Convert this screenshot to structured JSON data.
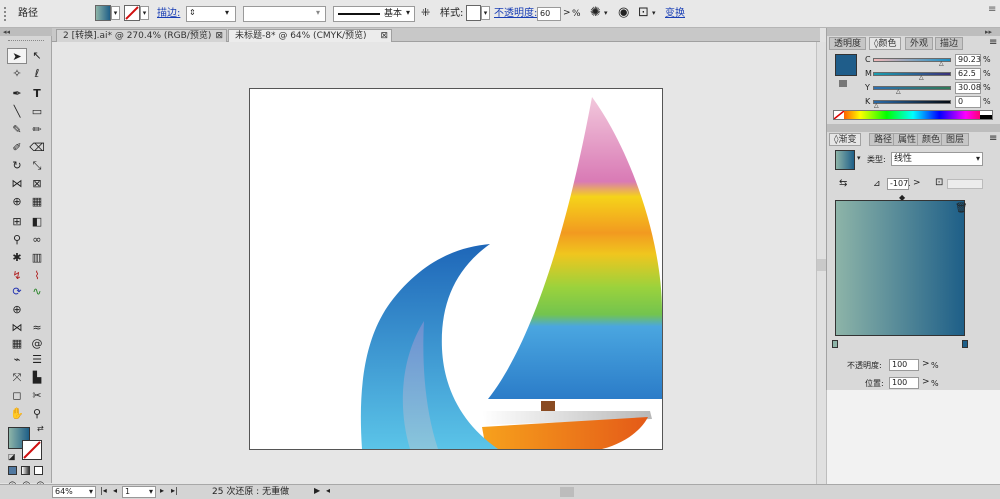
{
  "control_bar": {
    "selection_type": "路径",
    "stroke_label": "描边:",
    "stroke_weight": "",
    "brush_style": "基本",
    "style_label": "样式:",
    "opacity_label": "不透明度:",
    "opacity_value": "60",
    "opacity_unit": "%",
    "transform_label": "变换",
    "fill_color": "#4a7fa0"
  },
  "document_tabs": [
    {
      "label": "2 [转换].ai* @ 270.4% (RGB/预览)",
      "close": "⊠",
      "active": false
    },
    {
      "label": "未标题-8* @ 64% (CMYK/预览)",
      "close": "⊠",
      "active": true
    }
  ],
  "color_panel": {
    "tabs": [
      "透明度",
      "颜色",
      "外观",
      "描边"
    ],
    "active_tab": "颜色",
    "channels": [
      {
        "label": "C",
        "value": "90.23",
        "fraction": 0.9023
      },
      {
        "label": "M",
        "value": "62.5",
        "fraction": 0.625
      },
      {
        "label": "Y",
        "value": "30.08",
        "fraction": 0.3008
      },
      {
        "label": "K",
        "value": "0",
        "fraction": 0
      }
    ],
    "current_color": "#1f5d8a"
  },
  "gradient_panel": {
    "tabs": [
      "渐变",
      "路径",
      "属性",
      "颜色",
      "图层"
    ],
    "active_tab": "渐变",
    "type_label": "类型:",
    "type_value": "线性",
    "angle_value": "-107.",
    "start_color": "#8db4a8",
    "end_color": "#1e5f88",
    "opacity_label": "不透明度:",
    "opacity_value": "100",
    "location_label": "位置:",
    "location_value": "100",
    "percent": "%"
  },
  "status_bar": {
    "zoom": "64%",
    "artboard_number": "1",
    "undo_info": "25 次还原 : 无重做"
  }
}
